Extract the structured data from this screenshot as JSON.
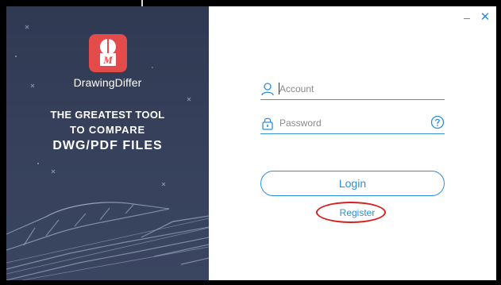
{
  "brand": {
    "name": "DrawingDiffer",
    "logo_letter": "M"
  },
  "left_panel": {
    "tagline_line1": "THE GREATEST TOOL",
    "tagline_line2": "TO COMPARE",
    "tagline_line3": "DWG/PDF FILES"
  },
  "window_controls": {
    "minimize": "–",
    "close": "✕"
  },
  "form": {
    "account_placeholder": "Account",
    "password_placeholder": "Password",
    "login_label": "Login",
    "register_label": "Register"
  },
  "icons": {
    "account": "user-icon",
    "password": "lock-icon",
    "help": "question-icon",
    "logo": "drawingdiffer-logo-icon"
  },
  "colors": {
    "accent": "#2d8ed8",
    "left_panel_bg": "#323c56",
    "logo_red": "#e44b4b",
    "highlight_ring": "#d71f1f"
  }
}
